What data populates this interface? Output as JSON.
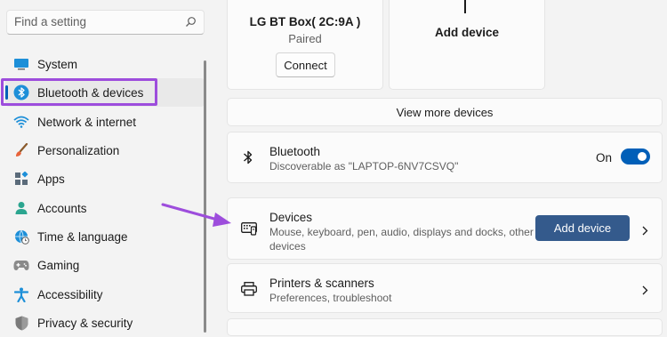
{
  "search": {
    "placeholder": "Find a setting",
    "icon": "search-icon"
  },
  "sidebar": {
    "items": [
      {
        "label": "System",
        "icon": "system-display-icon"
      },
      {
        "label": "Bluetooth & devices",
        "icon": "bluetooth-icon",
        "active": true
      },
      {
        "label": "Network & internet",
        "icon": "wifi-icon"
      },
      {
        "label": "Personalization",
        "icon": "brush-icon"
      },
      {
        "label": "Apps",
        "icon": "apps-icon"
      },
      {
        "label": "Accounts",
        "icon": "person-icon"
      },
      {
        "label": "Time & language",
        "icon": "globe-clock-icon"
      },
      {
        "label": "Gaming",
        "icon": "gamepad-icon"
      },
      {
        "label": "Accessibility",
        "icon": "accessibility-icon"
      },
      {
        "label": "Privacy & security",
        "icon": "shield-icon"
      }
    ]
  },
  "device_card": {
    "name": "LG BT Box( 2C:9A )",
    "status": "Paired",
    "connect_label": "Connect"
  },
  "add_device_card": {
    "label": "Add device"
  },
  "view_more": {
    "label": "View more devices"
  },
  "bluetooth_row": {
    "title": "Bluetooth",
    "subtitle": "Discoverable as \"LAPTOP-6NV7CSVQ\"",
    "toggle_state": "On",
    "toggle_on": true
  },
  "devices_row": {
    "title": "Devices",
    "subtitle_line1": "Mouse, keyboard, pen, audio, displays and docks, other",
    "subtitle_line2": "devices",
    "button_label": "Add device"
  },
  "printers_row": {
    "title": "Printers & scanners",
    "subtitle": "Preferences, troubleshoot"
  },
  "colors": {
    "accent": "#005fb8",
    "highlight": "#9d4ddc",
    "add_button": "#345a8c"
  }
}
